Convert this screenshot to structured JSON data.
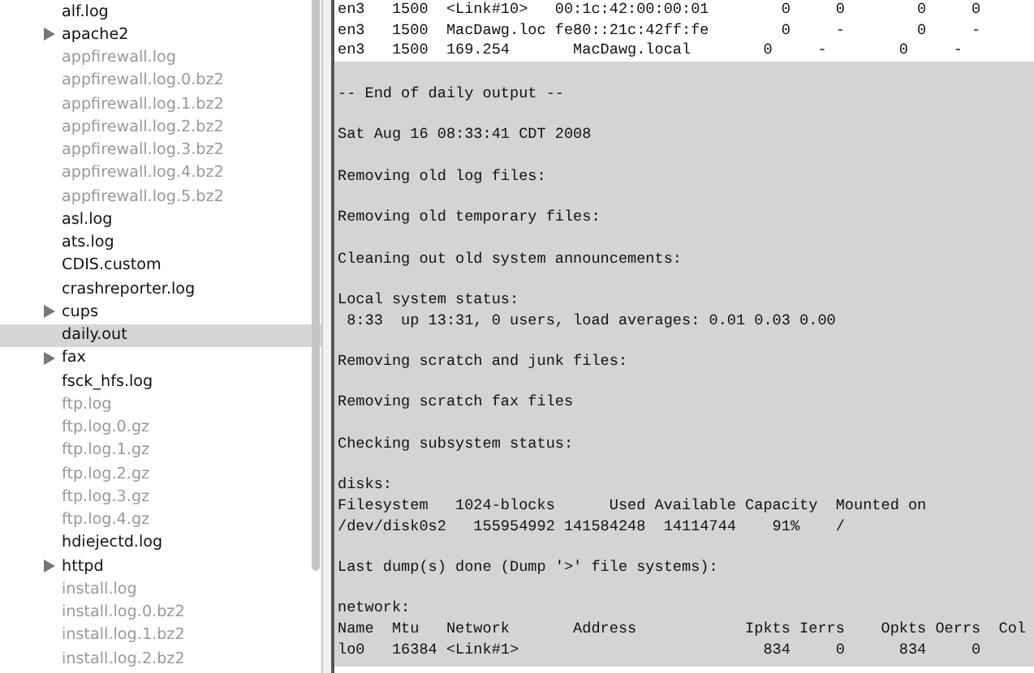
{
  "sidebar": {
    "items": [
      {
        "label": "alf.log",
        "kind": "file",
        "dimmed": false,
        "selected": false
      },
      {
        "label": "apache2",
        "kind": "folder",
        "dimmed": false,
        "selected": false
      },
      {
        "label": "appfirewall.log",
        "kind": "file",
        "dimmed": true,
        "selected": false
      },
      {
        "label": "appfirewall.log.0.bz2",
        "kind": "file",
        "dimmed": true,
        "selected": false
      },
      {
        "label": "appfirewall.log.1.bz2",
        "kind": "file",
        "dimmed": true,
        "selected": false
      },
      {
        "label": "appfirewall.log.2.bz2",
        "kind": "file",
        "dimmed": true,
        "selected": false
      },
      {
        "label": "appfirewall.log.3.bz2",
        "kind": "file",
        "dimmed": true,
        "selected": false
      },
      {
        "label": "appfirewall.log.4.bz2",
        "kind": "file",
        "dimmed": true,
        "selected": false
      },
      {
        "label": "appfirewall.log.5.bz2",
        "kind": "file",
        "dimmed": true,
        "selected": false
      },
      {
        "label": "asl.log",
        "kind": "file",
        "dimmed": false,
        "selected": false
      },
      {
        "label": "ats.log",
        "kind": "file",
        "dimmed": false,
        "selected": false
      },
      {
        "label": "CDIS.custom",
        "kind": "file",
        "dimmed": false,
        "selected": false
      },
      {
        "label": "crashreporter.log",
        "kind": "file",
        "dimmed": false,
        "selected": false
      },
      {
        "label": "cups",
        "kind": "folder",
        "dimmed": false,
        "selected": false
      },
      {
        "label": "daily.out",
        "kind": "file",
        "dimmed": false,
        "selected": true
      },
      {
        "label": "fax",
        "kind": "folder",
        "dimmed": false,
        "selected": false
      },
      {
        "label": "fsck_hfs.log",
        "kind": "file",
        "dimmed": false,
        "selected": false
      },
      {
        "label": "ftp.log",
        "kind": "file",
        "dimmed": true,
        "selected": false
      },
      {
        "label": "ftp.log.0.gz",
        "kind": "file",
        "dimmed": true,
        "selected": false
      },
      {
        "label": "ftp.log.1.gz",
        "kind": "file",
        "dimmed": true,
        "selected": false
      },
      {
        "label": "ftp.log.2.gz",
        "kind": "file",
        "dimmed": true,
        "selected": false
      },
      {
        "label": "ftp.log.3.gz",
        "kind": "file",
        "dimmed": true,
        "selected": false
      },
      {
        "label": "ftp.log.4.gz",
        "kind": "file",
        "dimmed": true,
        "selected": false
      },
      {
        "label": "hdiejectd.log",
        "kind": "file",
        "dimmed": false,
        "selected": false
      },
      {
        "label": "httpd",
        "kind": "folder",
        "dimmed": false,
        "selected": false
      },
      {
        "label": "install.log",
        "kind": "file",
        "dimmed": true,
        "selected": false
      },
      {
        "label": "install.log.0.bz2",
        "kind": "file",
        "dimmed": true,
        "selected": false
      },
      {
        "label": "install.log.1.bz2",
        "kind": "file",
        "dimmed": true,
        "selected": false
      },
      {
        "label": "install.log.2.bz2",
        "kind": "file",
        "dimmed": true,
        "selected": false
      }
    ]
  },
  "log": {
    "sections": [
      {
        "highlighted": false,
        "paragraphs": [
          [
            "en3   1500  <Link#10>   00:1c:42:00:00:01        0     0        0     0",
            "en3   1500  MacDawg.loc fe80::21c:42ff:fe        0     -        0     -",
            "en3   1500  169.254       MacDawg.local        0     -        0     -"
          ]
        ]
      },
      {
        "highlighted": true,
        "paragraphs": [
          [
            "-- End of daily output --"
          ],
          [
            "Sat Aug 16 08:33:41 CDT 2008"
          ],
          [
            "Removing old log files:"
          ],
          [
            "Removing old temporary files:"
          ],
          [
            "Cleaning out old system announcements:"
          ],
          [
            "Local system status:",
            " 8:33  up 13:31, 0 users, load averages: 0.01 0.03 0.00"
          ],
          [
            "Removing scratch and junk files:"
          ],
          [
            "Removing scratch fax files"
          ],
          [
            "Checking subsystem status:"
          ],
          [
            "disks:",
            "Filesystem   1024-blocks      Used Available Capacity  Mounted on",
            "/dev/disk0s2   155954992 141584248  14114744    91%    /"
          ],
          [
            "Last dump(s) done (Dump '>' file systems):"
          ],
          [
            "network:",
            "Name  Mtu   Network       Address            Ipkts Ierrs    Opkts Oerrs  Col",
            "lo0   16384 <Link#1>                           834     0      834     0"
          ]
        ]
      }
    ]
  }
}
